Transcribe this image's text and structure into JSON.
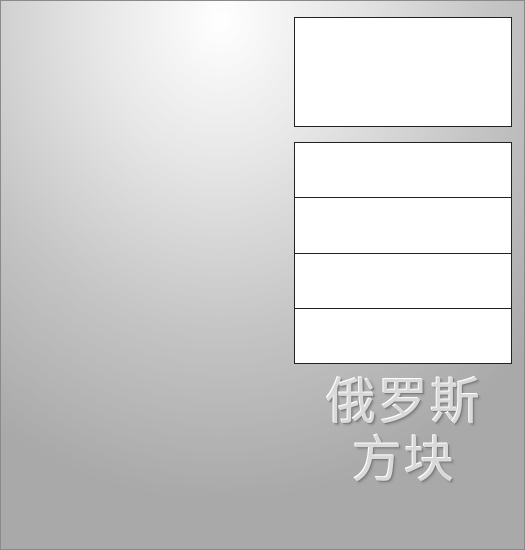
{
  "game": {
    "title_line1": "俄罗斯",
    "title_line2": "方块"
  },
  "panels": {
    "next_piece": "",
    "info": [
      "",
      "",
      "",
      ""
    ]
  }
}
